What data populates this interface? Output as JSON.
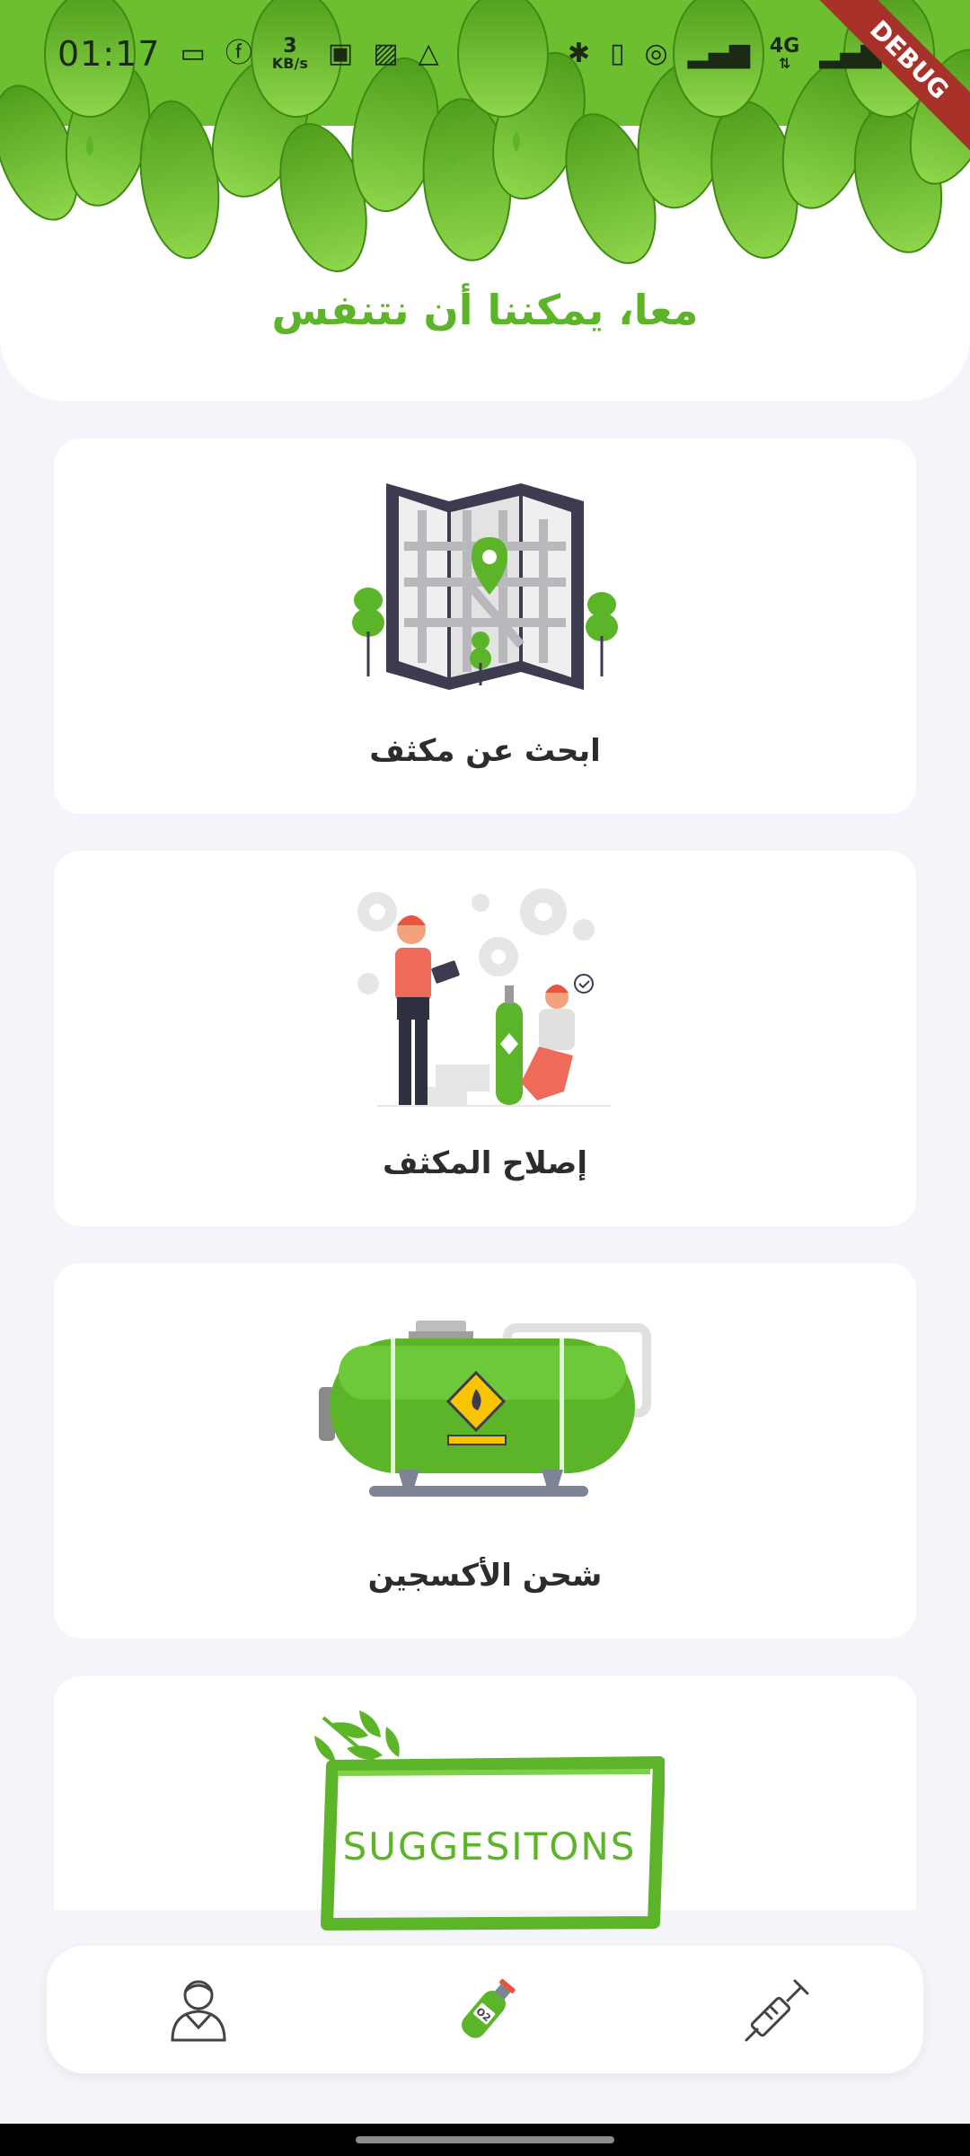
{
  "status_bar": {
    "time": "01:17",
    "network_speed_value": "3",
    "network_speed_unit": "KB/s",
    "debug_banner": "DEBUG",
    "network_type": "4G"
  },
  "header": {
    "tagline": "معا، يمكننا أن نتنفس"
  },
  "cards": [
    {
      "label": "ابحث عن مكثف",
      "icon": "map-pin-illustration"
    },
    {
      "label": "إصلاح المكثف",
      "icon": "repair-workers-illustration"
    },
    {
      "label": "شحن الأكسجين",
      "icon": "oxygen-tank-illustration"
    },
    {
      "label": "SUGGESITONS",
      "icon": "suggestions-stamp"
    }
  ],
  "bottom_nav": {
    "items": [
      {
        "icon": "user-profile-icon"
      },
      {
        "icon": "oxygen-bottle-icon",
        "badge": "O2"
      },
      {
        "icon": "syringe-icon"
      }
    ]
  },
  "colors": {
    "accent_green": "#5cb428",
    "background": "#f3f5fa",
    "card": "#ffffff",
    "text_dark": "#2c2c2c"
  }
}
